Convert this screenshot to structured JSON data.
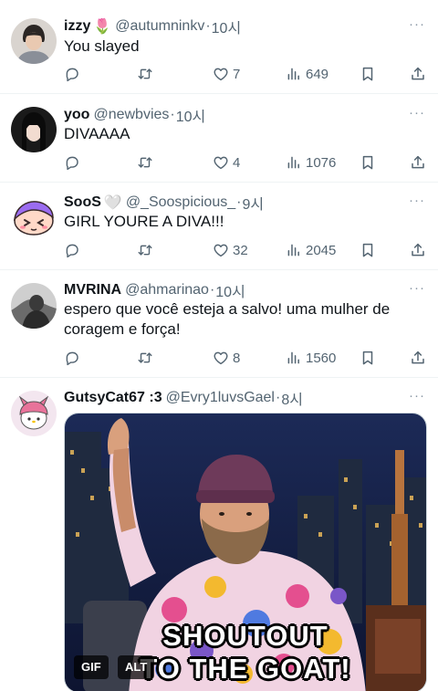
{
  "replies": [
    {
      "name": "izzy",
      "emoji": "🌷",
      "handle": "@autumninkv",
      "dot": "·",
      "time": "10시",
      "text": "You slayed",
      "likes": "7",
      "views": "649"
    },
    {
      "name": "yoo",
      "handle": "@newbvies",
      "dot": "·",
      "time": "10시",
      "text": "DIVAAAA",
      "likes": "4",
      "views": "1076"
    },
    {
      "name": "SooS",
      "emoji": "🤍",
      "handle": "@_Soospicious_",
      "dot": "·",
      "time": "9시",
      "text": "GIRL YOURE A DIVA!!!",
      "likes": "32",
      "views": "2045"
    },
    {
      "name": "MVRINA",
      "handle": "@ahmarinao",
      "dot": "·",
      "time": "10시",
      "text": "espero que você esteja a salvo! uma mulher de coragem e força!",
      "likes": "8",
      "views": "1560"
    },
    {
      "name": "GutsyCat67 :3",
      "handle": "@Evry1luvsGael",
      "dot": "·",
      "time": "8시",
      "media": {
        "caption_line1": "SHOUTOUT",
        "caption_line2": "TO THE GOAT!",
        "gif_badge": "GIF",
        "alt_badge": "ALT"
      }
    }
  ],
  "more_label": "···",
  "icons": {
    "more": "more-icon",
    "reply": "reply-icon",
    "retweet": "retweet-icon",
    "like": "heart-icon",
    "views": "views-icon",
    "bookmark": "bookmark-icon",
    "share": "share-icon"
  },
  "colors": {
    "text": "#0f1419",
    "secondary": "#536471",
    "divider": "#eff3f4"
  }
}
